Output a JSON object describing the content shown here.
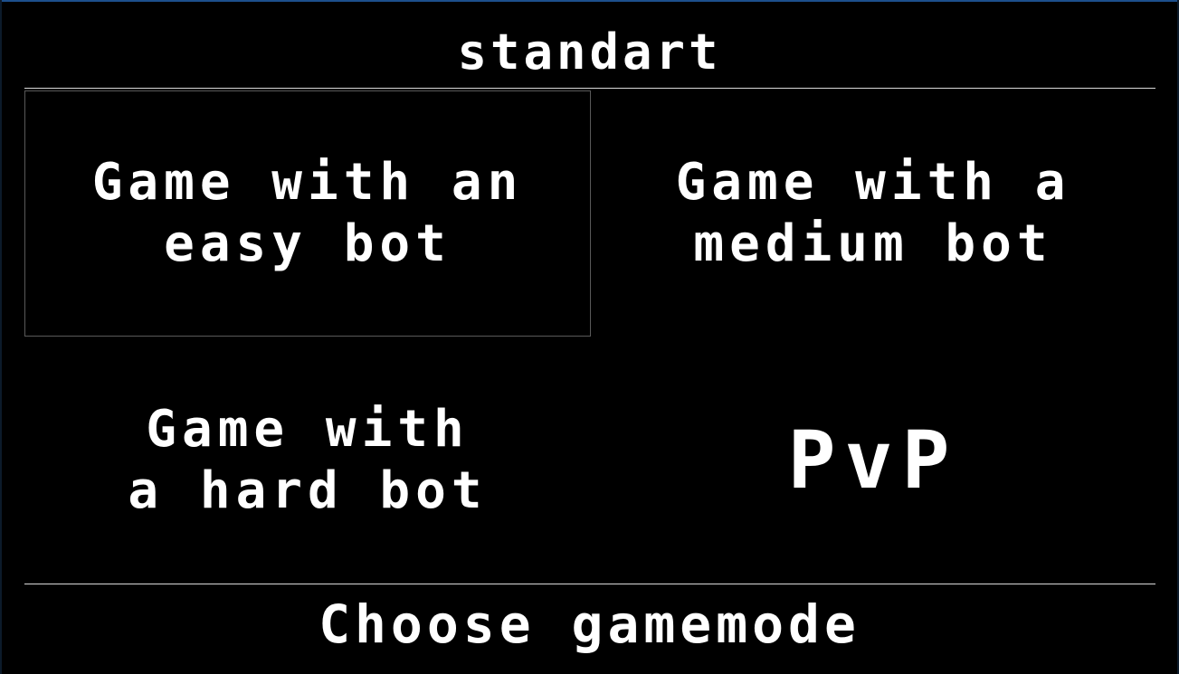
{
  "header": {
    "mode_name": "standart"
  },
  "menu": {
    "selected_index": 0,
    "options": [
      {
        "label": "Game with an\neasy bot"
      },
      {
        "label": "Game with a\nmedium bot"
      },
      {
        "label": "Game with\na hard bot"
      },
      {
        "label": "PvP"
      }
    ]
  },
  "footer": {
    "prompt": "Choose gamemode"
  },
  "colors": {
    "background": "#000000",
    "text": "#ffffff",
    "divider": "#d9d9d9",
    "selection_border": "#595959",
    "window_accent": "#1c4f8c"
  }
}
